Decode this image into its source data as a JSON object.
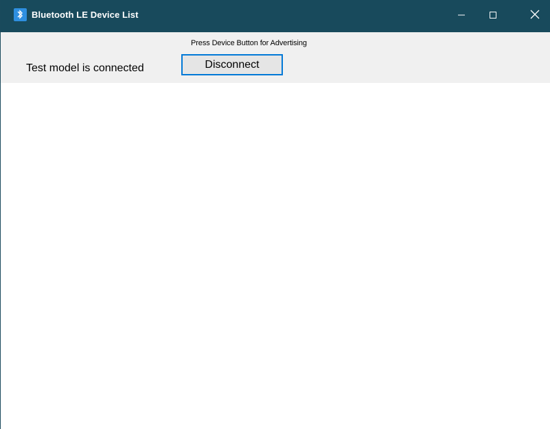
{
  "window": {
    "title": "Bluetooth LE Device List",
    "icon": "bluetooth-app-icon",
    "controls": {
      "minimize_icon": "minimize-icon",
      "maximize_icon": "maximize-icon",
      "close_icon": "close-icon"
    },
    "titlebar_color": "#184a5c"
  },
  "main": {
    "hint_text": "Press Device Button for Advertising",
    "status_text": "Test model is connected",
    "disconnect_label": "Disconnect",
    "accent_color": "#0078d7"
  }
}
